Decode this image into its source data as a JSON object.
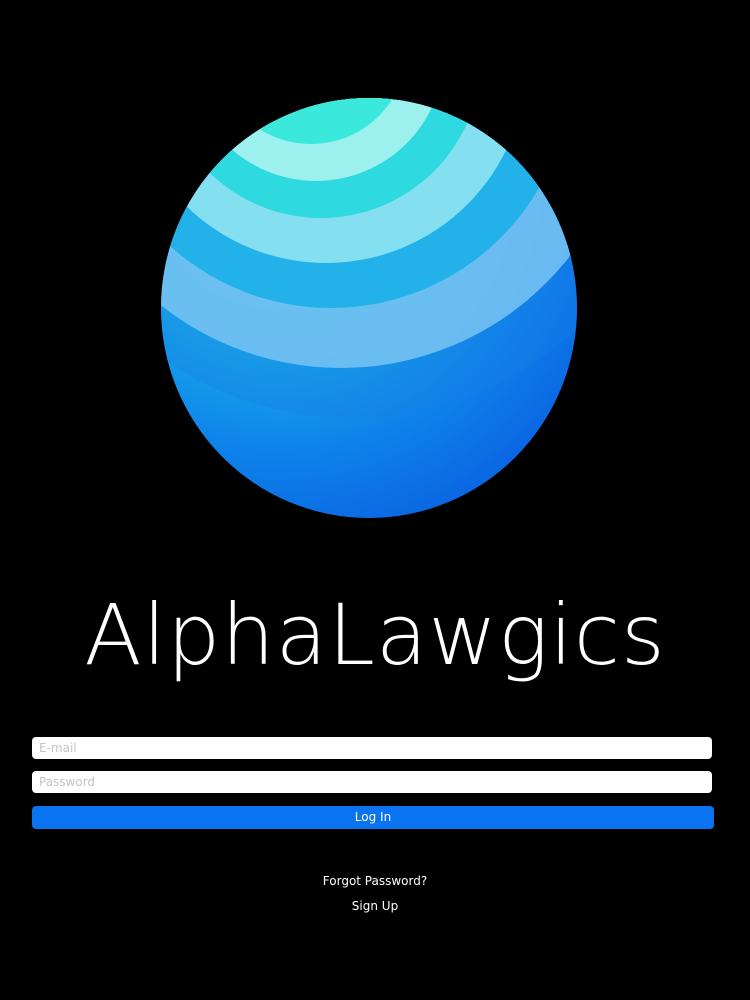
{
  "app": {
    "title": "AlphaLawgics",
    "logo_icon": "sphere-logo-icon"
  },
  "login_form": {
    "email_placeholder": "E-mail",
    "password_placeholder": "Password",
    "login_label": "Log In",
    "forgot_password_label": "Forgot Password?",
    "sign_up_label": "Sign Up"
  },
  "colors": {
    "background": "#000000",
    "accent": "#0a73f0",
    "logo_gradient_light": "#2ef0d8",
    "logo_gradient_dark": "#0a5fe0"
  }
}
